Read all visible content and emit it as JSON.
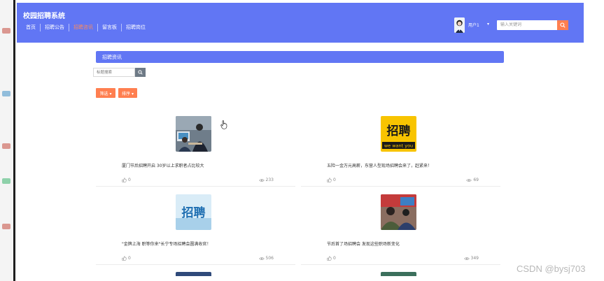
{
  "app": {
    "brand": "校园招聘系统"
  },
  "nav": [
    "首页",
    "招聘公告",
    "招聘咨讯",
    "留言板",
    "招聘岗位"
  ],
  "user": {
    "name": "用户1",
    "caret": "▾"
  },
  "top_search": {
    "placeholder": "输入关键词"
  },
  "section": {
    "title": "招聘资讯"
  },
  "search": {
    "placeholder": "标题搜索"
  },
  "filters": {
    "filter_label": "筛选 ▾",
    "sort_label": "排序 ▾"
  },
  "cards": [
    {
      "title": "厦门节后招聘开启 30岁以上求职者占比较大",
      "likes": "0",
      "views": "233",
      "thumb": "photo-interview"
    },
    {
      "title": "五险一金万元高薪，东营人型现场招聘会来了，赶紧来！",
      "likes": "0",
      "views": "69",
      "thumb": "poster-yellow"
    },
    {
      "title": "\"金牌上海 职等你来\"长宁专场招聘会圆满收官！",
      "likes": "0",
      "views": "506",
      "thumb": "poster-blue"
    },
    {
      "title": "节后首了场招聘会 发现这些职场新变化",
      "likes": "0",
      "views": "349",
      "thumb": "photo-crowd"
    }
  ],
  "poster_text": {
    "yellow_big": "招聘",
    "yellow_small": "we want you",
    "blue_big": "招聘"
  },
  "watermark": "CSDN @bysj703",
  "colors": {
    "primary": "#6176f4",
    "accent": "#ff7f50",
    "active_nav": "#ff8a5b"
  }
}
